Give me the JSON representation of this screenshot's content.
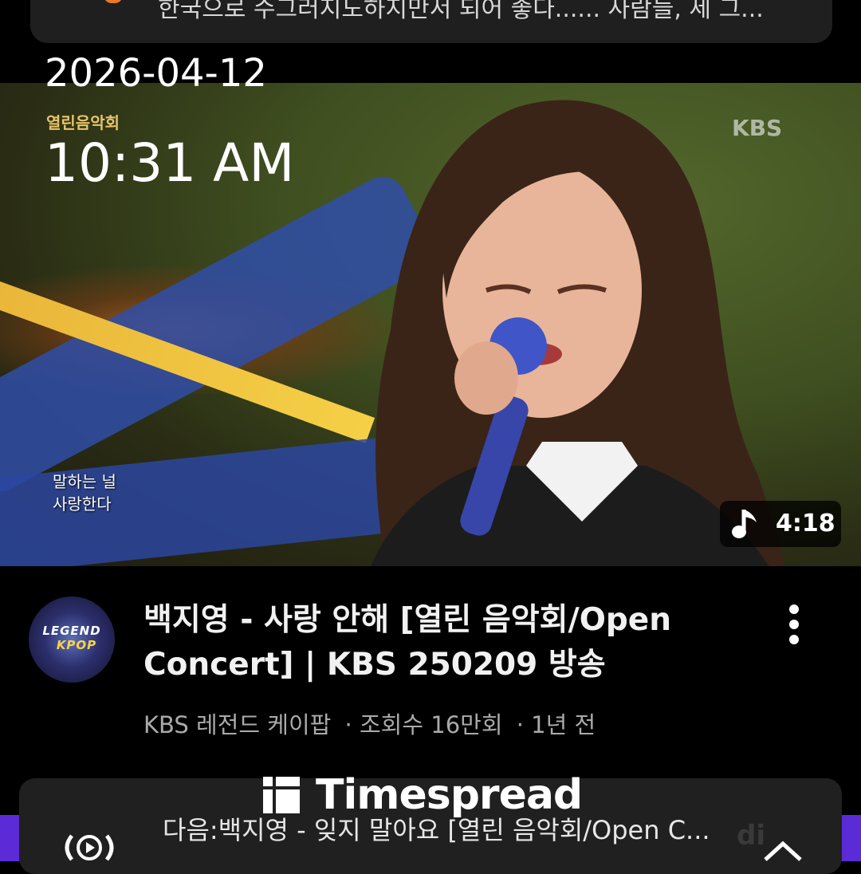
{
  "notification": {
    "text": "한국으로 수그러지도하지만서 되어 좋다...... 사람들, 세 그..."
  },
  "timestamp": {
    "date": "2026-04-12",
    "time": "10:31 AM"
  },
  "video": {
    "thumbnail_logo_left": "열린음악회",
    "thumbnail_logo_right": "KBS",
    "subtitle_line1": "말하는 널",
    "subtitle_line2": "사랑한다",
    "duration": "4:18",
    "title": "백지영 - 사랑 안해 [열린 음악회/Open Concert] | KBS 250209 방송",
    "channel": "KBS 레전드 케이팝",
    "views": "· 조회수 16만회",
    "age": "· 1년 전",
    "avatar_line1": "LEGEND",
    "avatar_line2": "KPOP"
  },
  "next_up": {
    "label": "다음:백지영 - 잊지 말아요 [열린 음악회/Open C...",
    "faint_brand": "di"
  },
  "watermark": {
    "text": "Timespread"
  },
  "colors": {
    "background": "#000000",
    "card": "#202020",
    "accent_purple": "#5b2bd8",
    "meta_text": "#aaaaaa"
  },
  "icons": [
    "music-note-icon",
    "more-vert-icon",
    "live-broadcast-icon",
    "chevron-up-icon",
    "timespread-logo-icon"
  ]
}
